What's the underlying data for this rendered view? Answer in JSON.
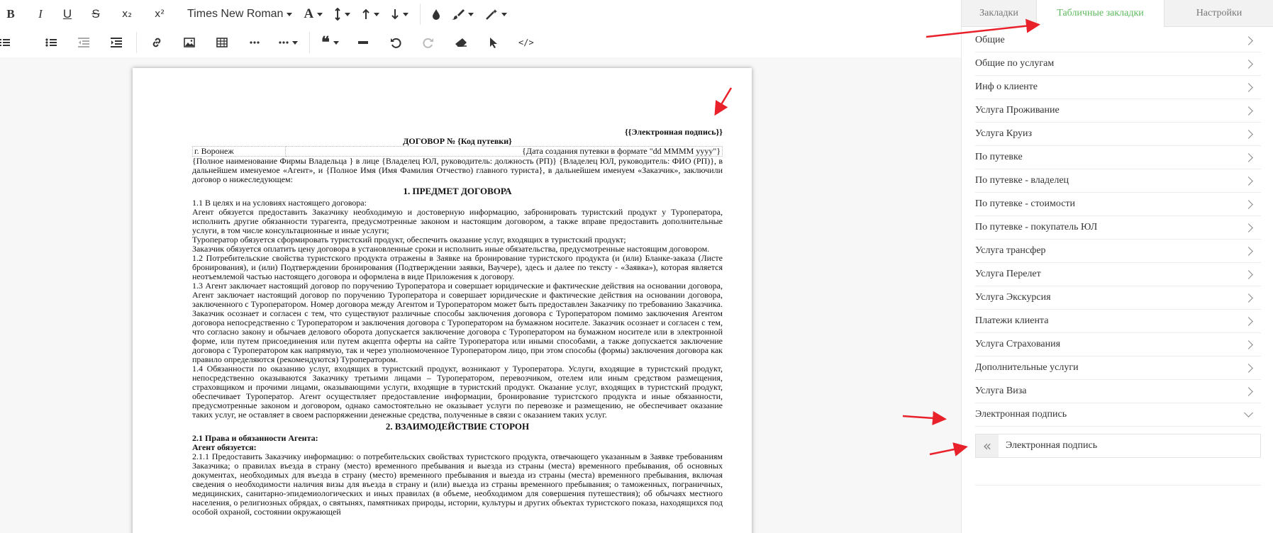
{
  "toolbar": {
    "font_name": "Times New Roman",
    "row1_icons": [
      "bold-icon",
      "italic-icon",
      "underline-icon",
      "strikethrough-icon",
      "subscript-icon",
      "superscript-icon"
    ],
    "row2_icons": [
      "ordered-list-icon",
      "unordered-list-icon",
      "outdent-icon",
      "indent-icon",
      "link-icon",
      "image-icon",
      "table-icon",
      "ellipsis-icon",
      "more-menu-icon",
      "blockquote-icon",
      "horizontal-rule-icon",
      "undo-icon",
      "redo-icon",
      "eraser-icon",
      "pointer-icon",
      "code-view-icon"
    ],
    "bold": "B",
    "italic": "I",
    "underline": "U",
    "strike": "S",
    "sub": "x₂",
    "sup": "x²",
    "fontsize": "A",
    "quote": "❝",
    "code": "</>"
  },
  "document": {
    "signature": "{{Электронная подпись}}",
    "title": "ДОГОВОР № {Код путевки}",
    "city": "г. Воронеж",
    "date": "{Дата создания путевки в формате \"dd MMMM yyyy\"}",
    "paragraphs_intro": [
      "{Полное наименование Фирмы Владельца } в лице {Владелец ЮЛ, руководитель: должность (РП)} {Владелец ЮЛ, руководитель: ФИО (РП)}, в дальнейшем именуемое «Агент», и {Полное Имя (Имя Фамилия Отчество) главного туриста}, в дальнейшем именуем «Заказчик», заключили договор о нижеследующем:"
    ],
    "section1_title": "1. ПРЕДМЕТ ДОГОВОРА",
    "section1": [
      "1.1 В целях и на условиях настоящего договора:",
      "Агент обязуется предоставить Заказчику необходимую и достоверную информацию, забронировать туристский продукт у Туроператора, исполнить другие обязанности турагента, предусмотренные законом и настоящим договором, а также вправе предоставить дополнительные услуги, в том числе консультационные и иные услуги;",
      "Туроператор обязуется сформировать туристский продукт, обеспечить оказание услуг, входящих в туристский продукт;",
      "Заказчик обязуется оплатить цену договора в установленные сроки и исполнить иные обязательства, предусмотренные настоящим договором.",
      "1.2 Потребительские свойства туристского продукта отражены в Заявке на бронирование туристского продукта (и (или) Бланке-заказа (Листе бронирования), и (или) Подтверждении бронирования (Подтверждении заявки, Ваучере), здесь и далее по тексту - «Заявка»), которая является неотъемлемой частью настоящего договора и оформлена в виде Приложения к договору.",
      "1.3 Агент заключает настоящий договор по поручению Туроператора и совершает юридические и фактические действия на основании договора, Агент заключает настоящий договор по поручению Туроператора и совершает юридические и фактические действия на основании договора, заключенного с Туроператором. Номер договора между Агентом и Туроператором может быть предоставлен Заказчику по требованию Заказчика.  Заказчик осознает и согласен с тем, что существуют различные способы заключения договора с Туроператором помимо заключения Агентом договора непосредственно с Туроператором и заключения договора с Туроператором на бумажном носителе. Заказчик осознает и согласен с тем, что согласно закону и обычаев делового оборота допускается заключение договора с Туроператором на бумажном носителе или в электронной форме, или путем присоединения или путем акцепта оферты на сайте Туроператора или иными способами, а также допускается заключение договора с Туроператором как напрямую, так и через уполномоченное Туроператором лицо, при этом способы (формы) заключения договора как правило определяются (рекомендуются) Туроператором.",
      "1.4 Обязанности по оказанию услуг, входящих в туристский продукт, возникают у Туроператора. Услуги, входящие в туристский продукт, непосредственно оказываются Заказчику третьими лицами – Туроператором, перевозчиком, отелем или иным средством размещения, страховщиком и прочими лицами, оказывающими услуги, входящие в туристский продукт. Оказание услуг, входящих в туристский продукт, обеспечивает Туроператор. Агент осуществляет предоставление информации, бронирование туристского продукта и иные обязанности, предусмотренные законом и договором, однако самостоятельно не оказывает услуги по перевозке и размещению, не обеспечивает оказание таких услуг, не оставляет в своем распоряжении денежные средства, полученные в связи с оказанием таких услуг."
    ],
    "section2_title": "2.    ВЗАИМОДЕЙСТВИЕ СТОРОН",
    "section2_sub1": "2.1 Права и обязанности Агента:",
    "section2_sub2": "Агент обязуется:",
    "section2": [
      "2.1.1 Предоставить Заказчику информацию: о потребительских свойствах туристского продукта, отвечающего указанным в Заявке требованиям Заказчика; о правилах въезда в страну (место) временного пребывания и выезда из страны (места) временного пребывания, об основных документах, необходимых для въезда в страну (место) временного пребывания и выезда из страны (места) временного пребывания, включая сведения о необходимости наличия визы для въезда в страну и (или) выезда из страны временного пребывания; о таможенных, пограничных, медицинских, санитарно-эпидемиологических и иных правилах (в объеме, необходимом для совершения путешествия); об обычаях местного населения, о религиозных обрядах, о святынях, памятниках природы, истории, культуры и других объектах туристского показа, находящихся под особой охраной, состоянии окружающей"
    ]
  },
  "panel": {
    "tabs": [
      "Закладки",
      "Табличные закладки",
      "Настройки"
    ],
    "active_tab": "Табличные закладки",
    "items": [
      "Общие",
      "Общие по услугам",
      "Инф о клиенте",
      "Услуга Проживание",
      "Услуга Круиз",
      "По путевке",
      "По путевке - владелец",
      "По путевке - стоимости",
      "По путевке - покупатель ЮЛ",
      "Услуга трансфер",
      "Услуга Перелет",
      "Услуга Экскурсия",
      "Платежи клиента",
      "Услуга Страхования",
      "Дополнительные услуги",
      "Услуга Виза",
      "Электронная подпись"
    ],
    "expanded_item": "Электронная подпись",
    "sub_item": "Электронная подпись",
    "colors": {
      "active_tab": "#5cb85c",
      "arrow": "#e8212a"
    }
  }
}
